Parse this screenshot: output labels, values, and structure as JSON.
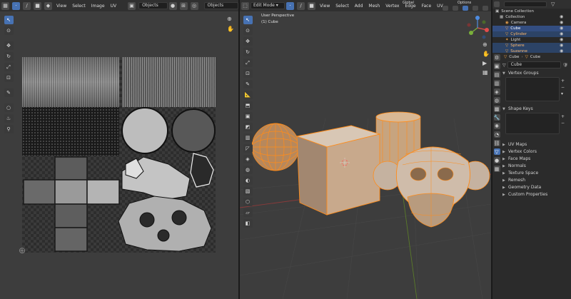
{
  "uv_editor": {
    "header": {
      "menus": [
        "View",
        "Select",
        "Image",
        "UV"
      ],
      "objects_field": "Objects",
      "objects_field2": "Objects"
    }
  },
  "viewport": {
    "header": {
      "mode": "Edit Mode",
      "menus": [
        "View",
        "Select",
        "Add",
        "Mesh",
        "Vertex",
        "Edge",
        "Face",
        "UV"
      ],
      "orientation": "Global",
      "options": "Options"
    },
    "overlay_title": "User Perspective",
    "overlay_object": "(1) Cube",
    "gizmo": {
      "x": "X",
      "y": "Y",
      "z": "Z"
    }
  },
  "outliner": {
    "root": "Scene Collection",
    "collection": "Collection",
    "items": [
      {
        "label": "Camera",
        "state": "normal"
      },
      {
        "label": "Cube",
        "state": "active"
      },
      {
        "label": "Cylinder",
        "state": "selected"
      },
      {
        "label": "Light",
        "state": "normal"
      },
      {
        "label": "Sphere",
        "state": "selected"
      },
      {
        "label": "Suzanne",
        "state": "selected"
      }
    ]
  },
  "properties": {
    "breadcrumb": [
      "Cube",
      "Cube"
    ],
    "data_name": "Cube",
    "panels": {
      "vertex_groups": "Vertex Groups",
      "shape_keys": "Shape Keys"
    },
    "collapsed_panels": [
      "UV Maps",
      "Vertex Colors",
      "Face Maps",
      "Normals",
      "Texture Space",
      "Remesh",
      "Geometry Data",
      "Custom Properties"
    ]
  },
  "colors": {
    "accent": "#4772b3",
    "selection_orange": "#ff8c1a",
    "background": "#3d3d3d",
    "header": "#303030"
  }
}
